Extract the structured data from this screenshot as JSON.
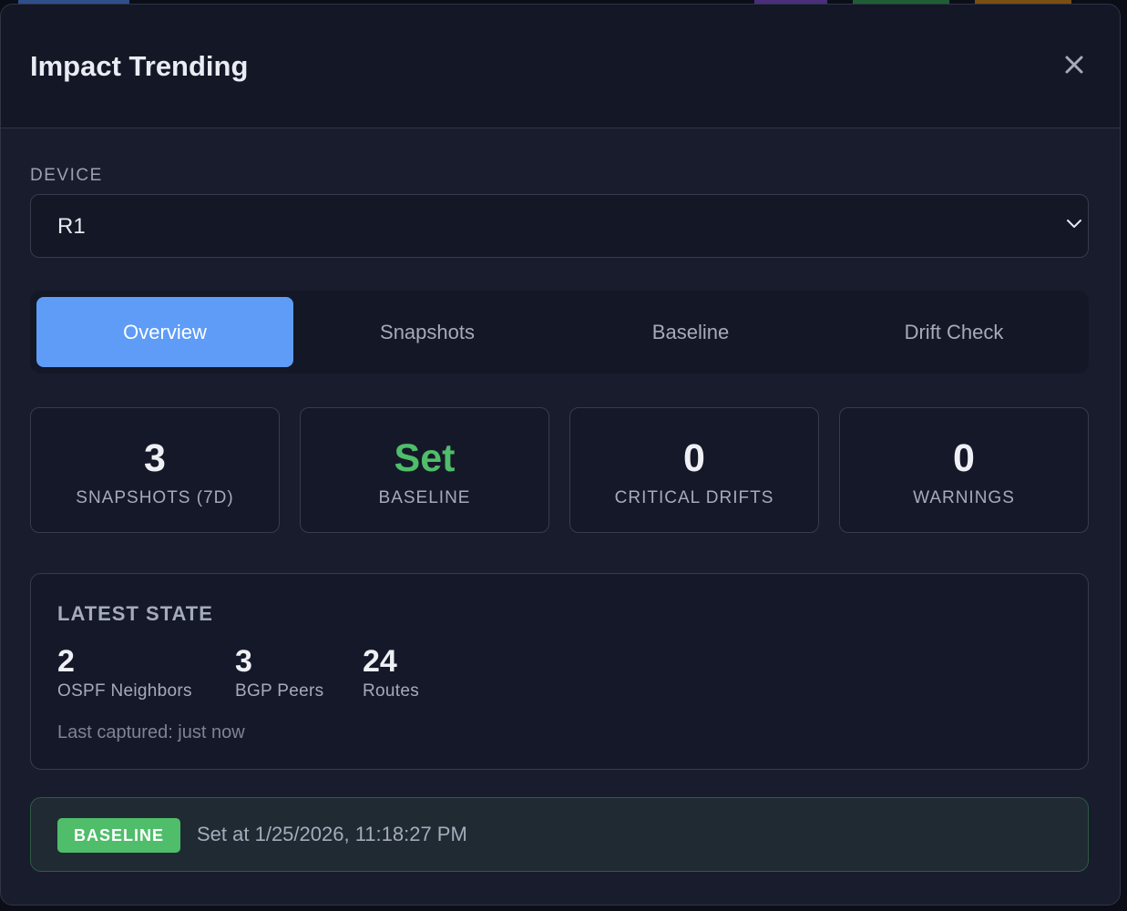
{
  "modal": {
    "title": "Impact Trending",
    "close_icon": "close-icon"
  },
  "device": {
    "label": "DEVICE",
    "selected": "R1",
    "chevron_icon": "chevron-down-icon"
  },
  "tabs": [
    {
      "label": "Overview",
      "active": true
    },
    {
      "label": "Snapshots",
      "active": false
    },
    {
      "label": "Baseline",
      "active": false
    },
    {
      "label": "Drift Check",
      "active": false
    }
  ],
  "stats": [
    {
      "value": "3",
      "label": "SNAPSHOTS (7D)",
      "color": "#eef0f5"
    },
    {
      "value": "Set",
      "label": "BASELINE",
      "color": "#4fbd6a"
    },
    {
      "value": "0",
      "label": "CRITICAL DRIFTS",
      "color": "#eef0f5"
    },
    {
      "value": "0",
      "label": "WARNINGS",
      "color": "#eef0f5"
    }
  ],
  "latest_state": {
    "title": "LATEST STATE",
    "metrics": [
      {
        "value": "2",
        "label": "OSPF Neighbors"
      },
      {
        "value": "3",
        "label": "BGP Peers"
      },
      {
        "value": "24",
        "label": "Routes"
      }
    ],
    "footer": "Last captured: just now"
  },
  "baseline_banner": {
    "badge": "BASELINE",
    "text": "Set at 1/25/2026, 11:18:27 PM"
  },
  "colors": {
    "accent": "#5e9cf7",
    "success": "#4fbd6a",
    "background": "#191c2c"
  }
}
